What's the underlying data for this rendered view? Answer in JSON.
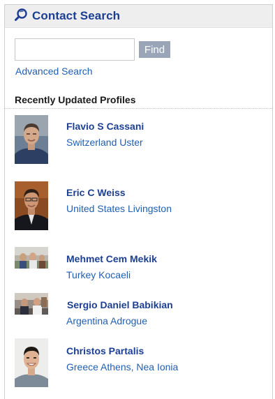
{
  "header": {
    "title": "Contact Search",
    "icon": "magnifier-icon"
  },
  "search": {
    "value": "",
    "placeholder": "",
    "find_label": "Find",
    "advanced_label": "Advanced Search"
  },
  "recent": {
    "title": "Recently Updated Profiles",
    "profiles": [
      {
        "name": "Flavio S Cassani",
        "location": "Switzerland Uster"
      },
      {
        "name": "Eric C Weiss",
        "location": "United States Livingston"
      },
      {
        "name": "Mehmet Cem Mekik",
        "location": "Turkey Kocaeli"
      },
      {
        "name": "Sergio Daniel Babikian",
        "location": "Argentina Adrogue"
      },
      {
        "name": "Christos Partalis",
        "location": "Greece Athens, Nea Ionia"
      }
    ]
  },
  "colors": {
    "accent": "#1c3f94",
    "link": "#1f5fb3",
    "button": "#9aa6b7",
    "header_bg": "#eeeeee"
  }
}
